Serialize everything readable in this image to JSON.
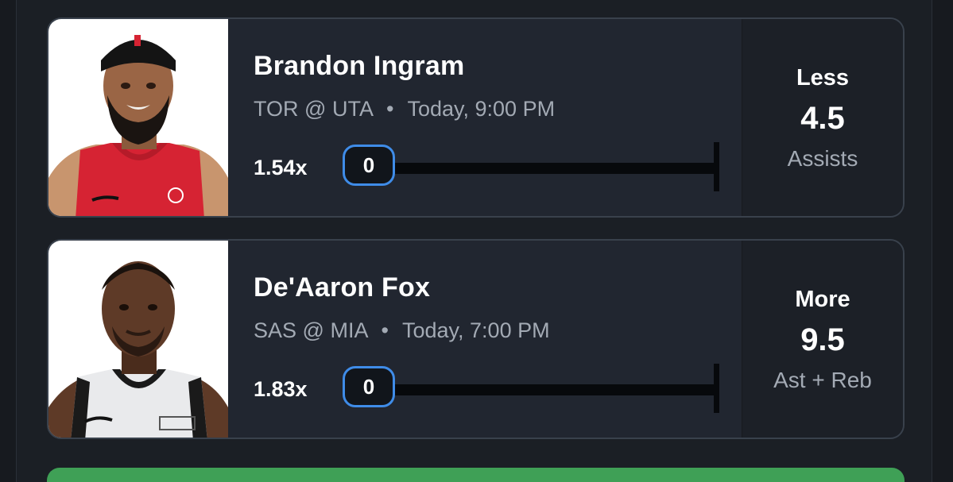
{
  "picks": [
    {
      "player": "Brandon Ingram",
      "team": "TOR",
      "opponent": "UTA",
      "time": "Today, 9:00 PM",
      "multiplier": "1.54x",
      "progress_value": "0",
      "direction": "Less",
      "line": "4.5",
      "stat": "Assists",
      "jersey_color": "#d62333"
    },
    {
      "player": "De'Aaron Fox",
      "team": "SAS",
      "opponent": "MIA",
      "time": "Today, 7:00 PM",
      "multiplier": "1.83x",
      "progress_value": "0",
      "direction": "More",
      "line": "9.5",
      "stat": "Ast + Reb",
      "jersey_color": "#e9eaec"
    }
  ],
  "separators": {
    "at": "@",
    "dot": "•"
  },
  "colors": {
    "background": "#1b1f25",
    "card": "#212630",
    "card_border": "#39414c",
    "pill_border": "#3f8ce8",
    "submit": "#3fa056"
  }
}
